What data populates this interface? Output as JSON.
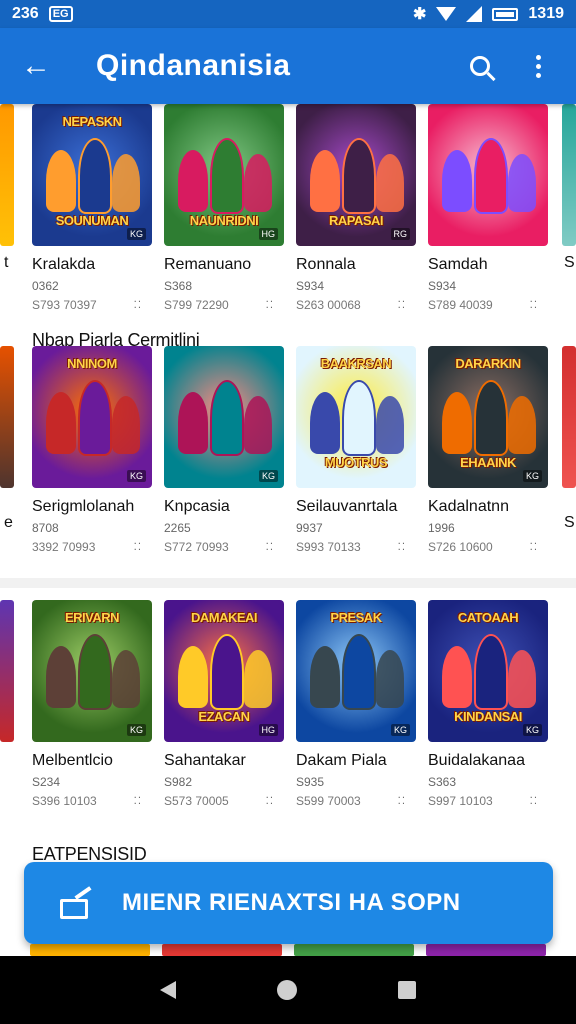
{
  "status_bar": {
    "time": "236",
    "right_time": "1319",
    "nfc_label": "EG"
  },
  "app_bar": {
    "title": "Qindananisia"
  },
  "section_labels": {
    "row2": "Nbap Pjarla Cermitlini",
    "row4": "EATPENSISID"
  },
  "rows": [
    [
      {
        "title": "Kralakda",
        "sub": "0362",
        "meta": "S793 70397",
        "cover_top": "NEPASKN",
        "cover_bottom": "SOUNUMAN",
        "badge": "KG",
        "colors": [
          "#1b3a8f",
          "#3b6fd6",
          "#ff9d2e"
        ]
      },
      {
        "title": "Remanuano",
        "sub": "S368",
        "meta": "S799 72290",
        "cover_top": "",
        "cover_bottom": "NAUNRIDNI",
        "badge": "HG",
        "colors": [
          "#2e7d32",
          "#81c784",
          "#d81b60"
        ]
      },
      {
        "title": "Ronnala",
        "sub": "S934",
        "meta": "S263 00068",
        "cover_top": "",
        "cover_bottom": "RAPASAI",
        "badge": "RG",
        "colors": [
          "#3e1f47",
          "#a64ac9",
          "#ff7043"
        ]
      },
      {
        "title": "Samdah",
        "sub": "S934",
        "meta": "S789 40039",
        "cover_top": "",
        "cover_bottom": "",
        "badge": "",
        "colors": [
          "#e91e63",
          "#f8bbd0",
          "#7c4dff"
        ]
      }
    ],
    [
      {
        "title": "Serigmlolanah",
        "sub": "8708",
        "meta": "3392 70993",
        "cover_top": "NNINOM",
        "cover_bottom": "",
        "badge": "KG",
        "colors": [
          "#6a1b9a",
          "#ff6f00",
          "#c62828"
        ]
      },
      {
        "title": "Knpcasia",
        "sub": "2265",
        "meta": "S772 70993",
        "cover_top": "",
        "cover_bottom": "",
        "badge": "KG",
        "colors": [
          "#00838f",
          "#ff8a80",
          "#ad1457"
        ]
      },
      {
        "title": "Seilauvanrtala",
        "sub": "9937",
        "meta": "S993 70133",
        "cover_top": "BAAKRSAN",
        "cover_bottom": "MUOTRUS",
        "badge": "",
        "colors": [
          "#e1f5fe",
          "#ffeb3b",
          "#3949ab"
        ]
      },
      {
        "title": "Kadalnatnn",
        "sub": "1996",
        "meta": "S726 10600",
        "cover_top": "DARARKIN",
        "cover_bottom": "EHAAINK",
        "badge": "KG",
        "colors": [
          "#263238",
          "#8d6e63",
          "#ef6c00"
        ]
      }
    ],
    [
      {
        "title": "Melbentlcio",
        "sub": "S234",
        "meta": "S396 10103",
        "cover_top": "ERIVARN",
        "cover_bottom": "",
        "badge": "KG",
        "colors": [
          "#33691e",
          "#9ccc65",
          "#5d4037"
        ]
      },
      {
        "title": "Sahantakar",
        "sub": "S982",
        "meta": "S573 70005",
        "cover_top": "DAMAKEAI",
        "cover_bottom": "EZACAN",
        "badge": "HG",
        "colors": [
          "#4a148c",
          "#ff7043",
          "#ffca28"
        ]
      },
      {
        "title": "Dakam Piala",
        "sub": "S935",
        "meta": "S599 70003",
        "cover_top": "PRESAK",
        "cover_bottom": "",
        "badge": "KG",
        "colors": [
          "#0d47a1",
          "#90caf9",
          "#37474f"
        ]
      },
      {
        "title": "Buidalakanaa",
        "sub": "S363",
        "meta": "S997 10103",
        "cover_top": "CATOAAH",
        "cover_bottom": "KINDANSAI",
        "badge": "KG",
        "colors": [
          "#1a237e",
          "#3f51b5",
          "#ff5252"
        ]
      }
    ]
  ],
  "edge_text": {
    "row1": "S",
    "row2": "S",
    "row3": ""
  },
  "fab": {
    "label": "MIENR RIENAXTSI HA SOPN"
  }
}
